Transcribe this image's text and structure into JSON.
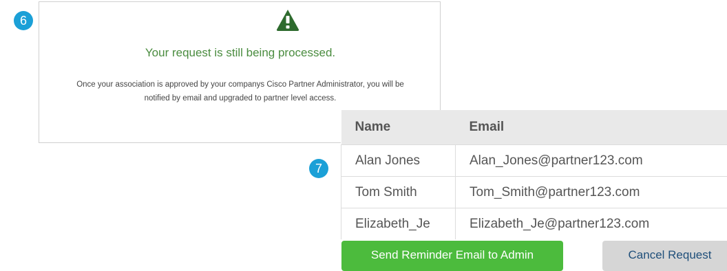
{
  "badges": {
    "step_6": "6",
    "step_7": "7"
  },
  "status_panel": {
    "icon": "warning-triangle-icon",
    "heading": "Your request is still being processed.",
    "message": "Once your association is approved by your companys Cisco Partner Administrator, you will be notified by email and upgraded to partner level access."
  },
  "admin_table": {
    "columns": [
      "Name",
      "Email"
    ],
    "rows": [
      {
        "name": "Alan Jones",
        "email": "Alan_Jones@partner123.com"
      },
      {
        "name": "Tom Smith",
        "email": "Tom_Smith@partner123.com"
      },
      {
        "name": "Elizabeth_Je",
        "email": "Elizabeth_Je@partner123.com"
      }
    ]
  },
  "actions": {
    "send_reminder_label": "Send Reminder Email to Admin",
    "cancel_label": "Cancel Request"
  },
  "colors": {
    "badge": "#1ba0d7",
    "success_green": "#4a8c3f",
    "primary_button": "#4cbb3d",
    "secondary_button": "#d6d6d6"
  }
}
